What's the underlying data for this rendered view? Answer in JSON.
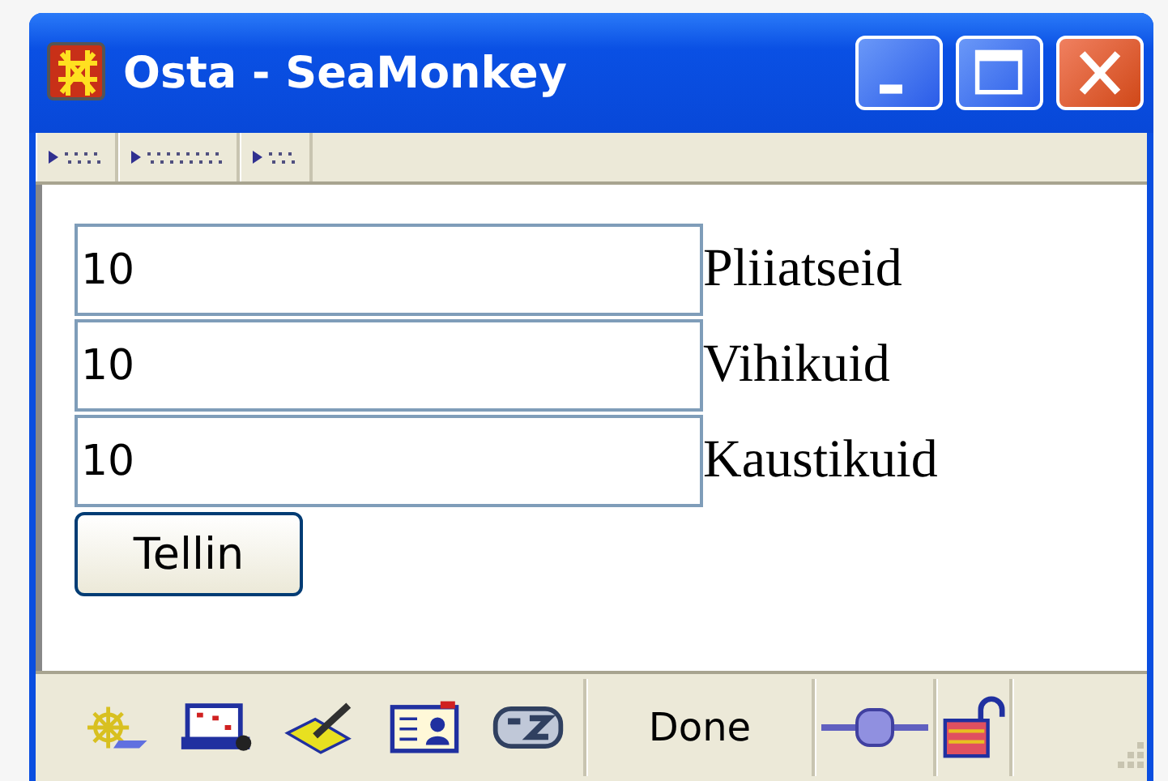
{
  "window": {
    "title": "Osta - SeaMonkey"
  },
  "form": {
    "fields": [
      {
        "value": "10",
        "label": "Pliiatseid"
      },
      {
        "value": "10",
        "label": "Vihikuid"
      },
      {
        "value": "10",
        "label": "Kaustikuid"
      }
    ],
    "button": "Tellin"
  },
  "status_bar": {
    "text": "Done"
  }
}
